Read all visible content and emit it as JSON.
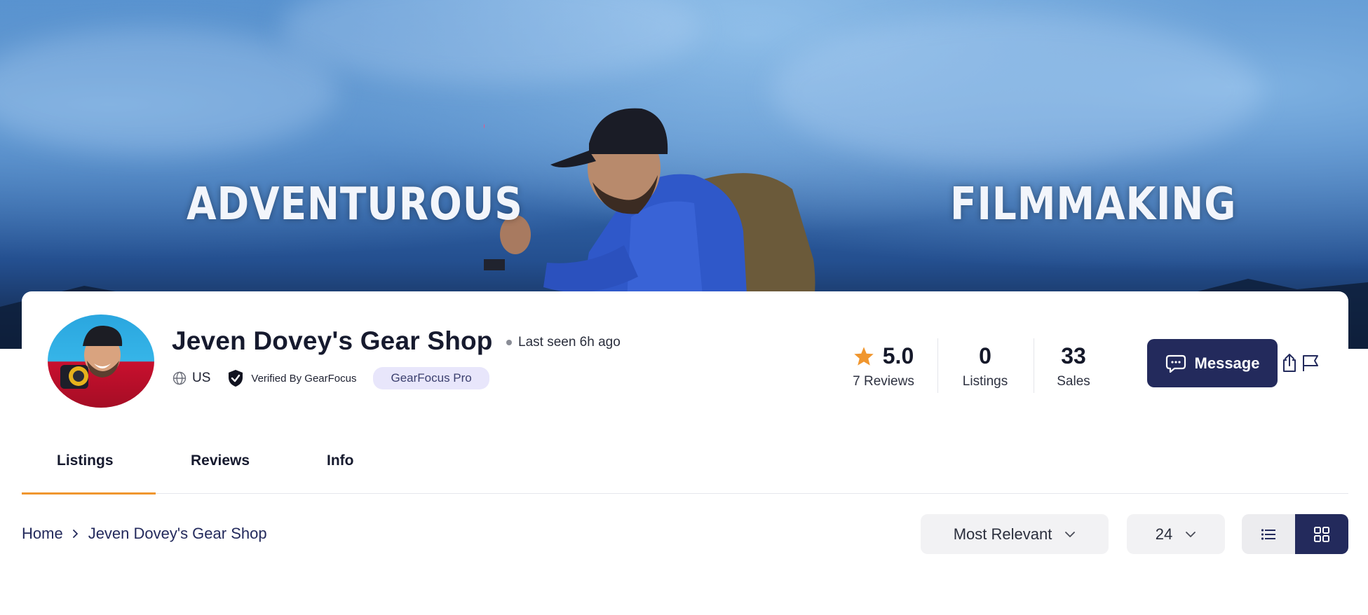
{
  "banner": {
    "left_text": "ADVENTUROUS",
    "right_text": "FILMMAKING"
  },
  "profile": {
    "shop_name": "Jeven Dovey's Gear Shop",
    "last_seen": "Last seen 6h ago",
    "country": "US",
    "verified_label": "Verified By GearFocus",
    "pro_badge": "GearFocus Pro"
  },
  "stats": {
    "rating": "5.0",
    "reviews_label": "7 Reviews",
    "listings_value": "0",
    "listings_label": "Listings",
    "sales_value": "33",
    "sales_label": "Sales"
  },
  "actions": {
    "message_label": "Message",
    "share_icon": "share-icon",
    "report_icon": "flag-icon"
  },
  "tabs": [
    {
      "label": "Listings",
      "active": true
    },
    {
      "label": "Reviews",
      "active": false
    },
    {
      "label": "Info",
      "active": false
    }
  ],
  "breadcrumb": {
    "home": "Home",
    "current": "Jeven Dovey's Gear Shop"
  },
  "controls": {
    "sort_value": "Most Relevant",
    "per_page_value": "24",
    "view_mode": "grid"
  },
  "colors": {
    "primary": "#232a5c",
    "accent": "#f0962e",
    "star": "#f0962e",
    "pro_badge_bg": "#e8e6fb"
  }
}
